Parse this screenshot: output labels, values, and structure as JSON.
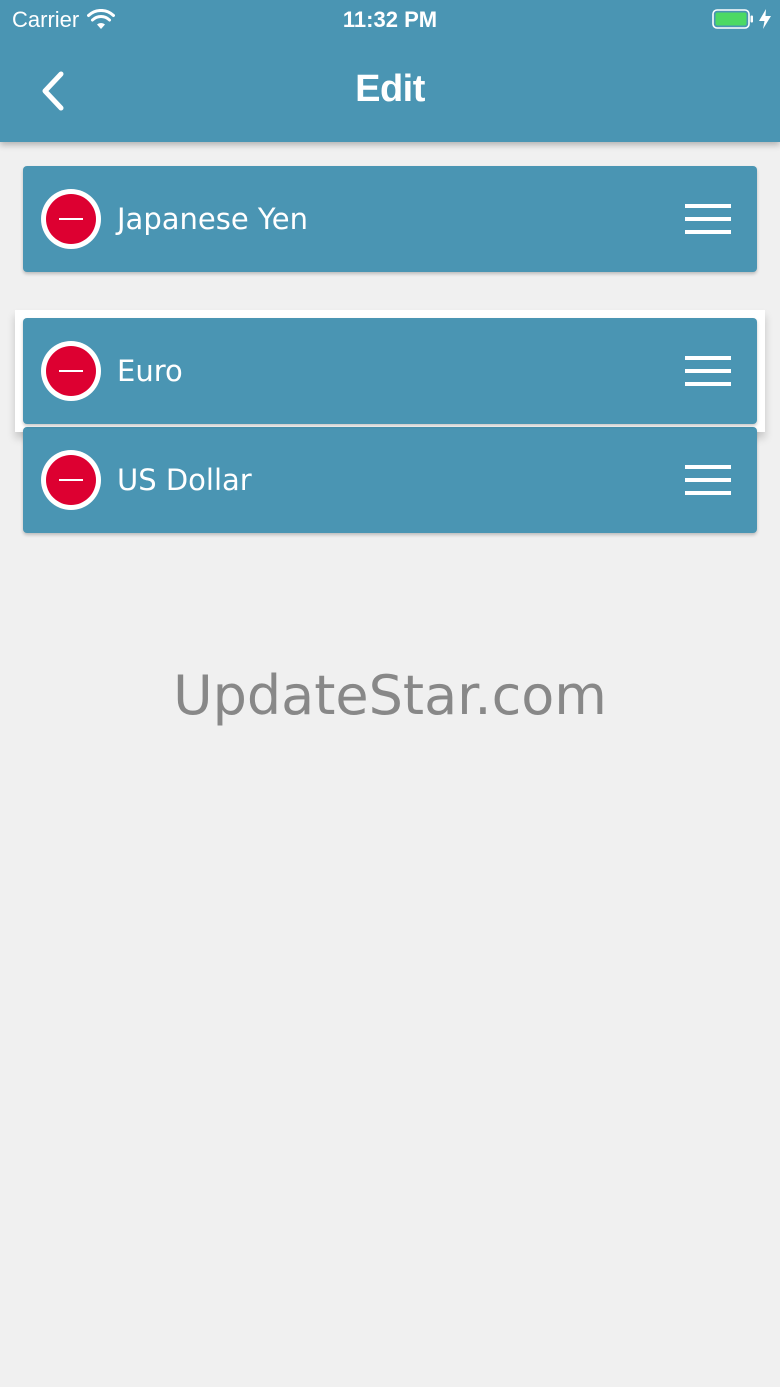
{
  "status_bar": {
    "carrier": "Carrier",
    "time": "11:32 PM",
    "wifi_icon": "wifi-icon",
    "battery_icon": "battery-icon",
    "charging_icon": "bolt-icon"
  },
  "navbar": {
    "title": "Edit",
    "back_icon": "chevron-left-icon"
  },
  "currencies": [
    {
      "label": "Japanese Yen",
      "delete_icon": "minus-circle-icon",
      "handle_icon": "drag-handle-icon"
    },
    {
      "label": "Euro",
      "delete_icon": "minus-circle-icon",
      "handle_icon": "drag-handle-icon",
      "dragging": true
    },
    {
      "label": "US Dollar",
      "delete_icon": "minus-circle-icon",
      "handle_icon": "drag-handle-icon"
    }
  ],
  "watermark": "UpdateStar.com",
  "colors": {
    "primary": "#4a95b3",
    "background": "#f0f0f0",
    "delete": "#dd0031",
    "battery": "#4cd964"
  }
}
